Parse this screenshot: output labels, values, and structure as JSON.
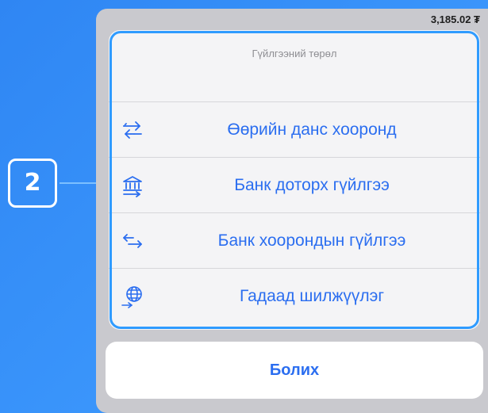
{
  "status": {
    "balance": "3,185.02 ₮"
  },
  "sheet": {
    "title": "Гүйлгээний төрөл",
    "options": [
      {
        "label": "Өөрийн данс хооронд",
        "icon": "swap-arrows-icon"
      },
      {
        "label": "Банк доторх гүйлгээ",
        "icon": "bank-icon"
      },
      {
        "label": "Банк хоорондын гүйлгээ",
        "icon": "transfer-arrows-icon"
      },
      {
        "label": "Гадаад шилжүүлэг",
        "icon": "globe-icon"
      }
    ]
  },
  "cancel": {
    "label": "Болих"
  },
  "annotation": {
    "step": "2"
  },
  "colors": {
    "accent": "#2b6ef0",
    "highlight": "#2f9bff",
    "background": "#3a95fb"
  }
}
